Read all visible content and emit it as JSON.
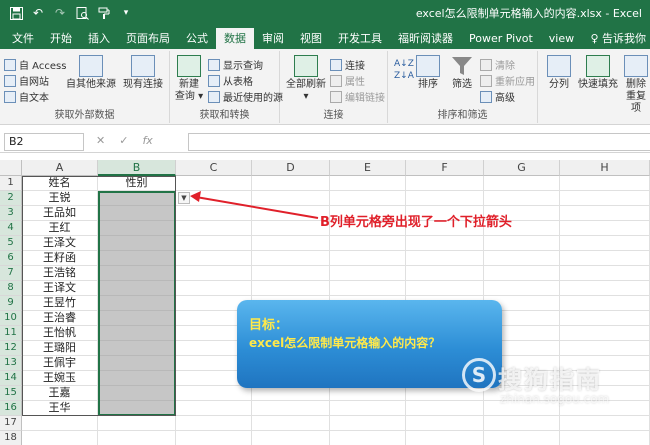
{
  "window": {
    "title": "excel怎么限制单元格输入的内容.xlsx - Excel"
  },
  "tabs": [
    "文件",
    "开始",
    "插入",
    "页面布局",
    "公式",
    "数据",
    "审阅",
    "视图",
    "开发工具",
    "福昕阅读器",
    "Power Pivot",
    "view"
  ],
  "active_tab": "数据",
  "tell_me": "告诉我你",
  "ribbon": {
    "get_external": {
      "access": "自 Access",
      "web": "自网站",
      "text": "自文本",
      "other": "自其他来源",
      "existing": "现有连接",
      "title": "获取外部数据"
    },
    "get_transform": {
      "new_query": "新建",
      "new_query2": "查询 ▾",
      "show_query": "显示查询",
      "from_table": "从表格",
      "recent": "最近使用的源",
      "title": "获取和转换"
    },
    "connections": {
      "refresh_all": "全部刷新",
      "refresh_all2": "▾",
      "connections": "连接",
      "properties": "属性",
      "edit_links": "编辑链接",
      "title": "连接"
    },
    "sort_filter": {
      "sort": "排序",
      "filter": "筛选",
      "clear": "清除",
      "reapply": "重新应用",
      "advanced": "高级",
      "title": "排序和筛选"
    },
    "data_tools": {
      "split": "分列",
      "flash_fill": "快速填充",
      "remove_dup": "删除",
      "remove_dup2": "重复项"
    }
  },
  "formula_bar": {
    "name_box": "B2",
    "cancel": "✕",
    "enter": "✓",
    "fx": "fx"
  },
  "columns": [
    "A",
    "B",
    "C",
    "D",
    "E",
    "F",
    "G",
    "H"
  ],
  "rows": [
    "1",
    "2",
    "3",
    "4",
    "5",
    "6",
    "7",
    "8",
    "9",
    "10",
    "11",
    "12",
    "13",
    "14",
    "15",
    "16",
    "17",
    "18"
  ],
  "sheet": {
    "header_a": "姓名",
    "header_b": "性别",
    "names": [
      "王锐",
      "王品如",
      "王红",
      "王泽文",
      "王籽函",
      "王浩铭",
      "王译文",
      "王昱竹",
      "王治睿",
      "王怡帆",
      "王璐阳",
      "王佩宇",
      "王婉玉",
      "王嘉",
      "王华"
    ]
  },
  "annotation": {
    "text": "B列单元格旁出现了一个下拉箭头",
    "color": "#e0202a"
  },
  "callout": {
    "line1": "目标：",
    "line2": "excel怎么限制单元格输入的内容？"
  },
  "watermark": {
    "logo": "S",
    "text": "搜狗指南",
    "url": "zhinan.sogou.com"
  },
  "colors": {
    "excel_green": "#217346",
    "arrow_red": "#e0202a",
    "callout_text": "#ffe94a"
  }
}
